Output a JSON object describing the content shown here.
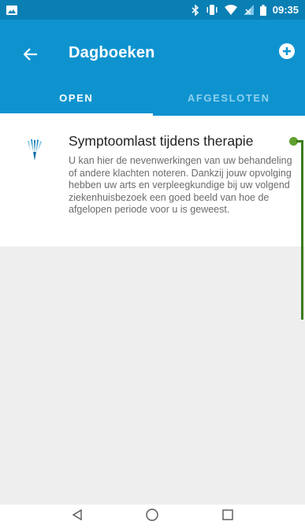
{
  "status_bar": {
    "time": "09:35",
    "icons": [
      "image-icon",
      "bluetooth-icon",
      "vibrate-icon",
      "wifi-icon",
      "signal-icon",
      "battery-icon"
    ]
  },
  "app_bar": {
    "title": "Dagboeken",
    "back_icon": "arrow-left-icon",
    "add_icon": "add-circle-icon",
    "background": "#0e93cf"
  },
  "tabs": [
    {
      "label": "OPEN",
      "active": true
    },
    {
      "label": "AFGESLOTEN",
      "active": false
    }
  ],
  "diaries": [
    {
      "title": "Symptoomlast tijdens therapie",
      "description": "U kan hier de nevenwerkingen van uw behandeling of andere klachten noteren. Dankzij jouw opvolging hebben uw arts en verpleegkundige bij uw volgend ziekenhuisbezoek een goed beeld van hoe de afgelopen periode voor u is geweest.",
      "icon": "hospital-logo-icon"
    }
  ],
  "colors": {
    "status_bar": "#0a7fb4",
    "accent": "#0e93cf",
    "callout": "#5fa02e"
  },
  "nav_bar": {
    "icons": [
      "back-triangle-icon",
      "home-circle-icon",
      "recents-square-icon"
    ]
  }
}
